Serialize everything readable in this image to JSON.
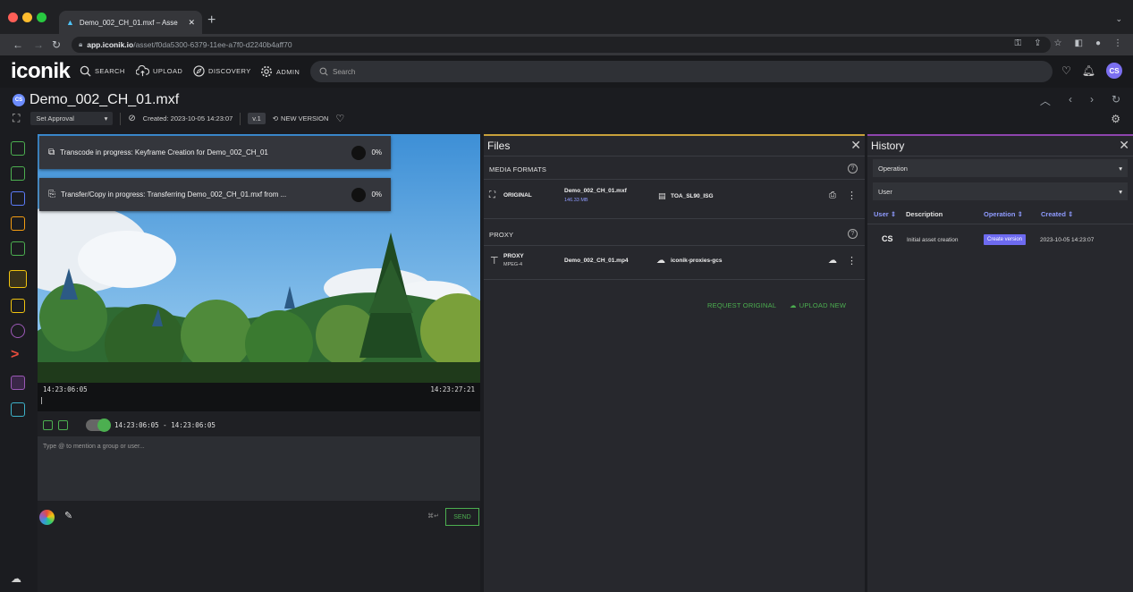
{
  "browser": {
    "tab_title": "Demo_002_CH_01.mxf – Asse",
    "url_host": "app.iconik.io",
    "url_path": "/asset/f0da5300-6379-11ee-a7f0-d2240b4aff70"
  },
  "topbar": {
    "logo": "iconik",
    "nav": [
      "SEARCH",
      "UPLOAD",
      "DISCOVERY",
      "ADMIN"
    ],
    "search_placeholder": "Search",
    "avatar": "CS"
  },
  "asset": {
    "title": "Demo_002_CH_01.mxf",
    "avatar": "CS",
    "approval_label": "Set Approval",
    "created": "Created: 2023-10-05 14:23:07",
    "version": "v.1",
    "new_version": "NEW VERSION"
  },
  "player": {
    "toasts": [
      {
        "message": "Transcode in progress: Keyframe Creation for Demo_002_CH_01",
        "percent": "0%"
      },
      {
        "message": "Transfer/Copy in progress: Transferring Demo_002_CH_01.mxf from ...",
        "percent": "0%"
      }
    ],
    "timecode_start": "14:23:06:05",
    "timecode_end": "14:23:27:21",
    "range": "14:23:06:05 - 14:23:06:05",
    "comment_placeholder": "Type @ to mention a group or user...",
    "shortcut": "⌘↵",
    "send": "SEND"
  },
  "files": {
    "title": "Files",
    "media_formats_label": "MEDIA FORMATS",
    "proxy_label": "PROXY",
    "original": {
      "format": "ORIGINAL",
      "filename": "Demo_002_CH_01.mxf",
      "size": "146.33 MB",
      "storage": "TOA_SL90_ISG"
    },
    "proxy": {
      "format": "PROXY",
      "codec": "MPEG-4",
      "filename": "Demo_002_CH_01.mp4",
      "storage": "iconik-proxies-gcs"
    },
    "request_original": "REQUEST ORIGINAL",
    "upload_new": "UPLOAD NEW"
  },
  "history": {
    "title": "History",
    "filter_operation": "Operation",
    "filter_user": "User",
    "columns": [
      "User",
      "Description",
      "Operation",
      "Created"
    ],
    "rows": [
      {
        "user": "CS",
        "description": "Initial asset creation",
        "operation": "Create version",
        "created": "2023-10-05 14:23:07"
      }
    ]
  },
  "colors": {
    "accent_green": "#4caf50",
    "accent_blue": "#6d6af0",
    "files_border": "#c8a13b",
    "history_border": "#8e44ad"
  }
}
